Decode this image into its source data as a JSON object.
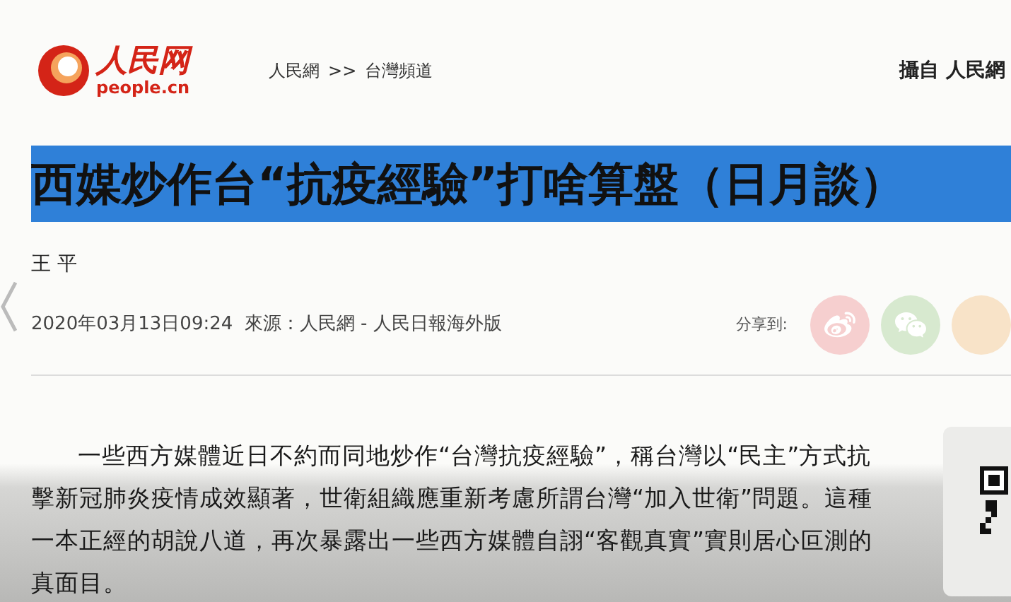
{
  "header": {
    "logo": {
      "name": "人民网",
      "domain": "people.cn"
    },
    "breadcrumb": [
      "人民網",
      ">>",
      "台灣頻道"
    ],
    "source_caption": "攝自 人民網"
  },
  "article": {
    "title": "西媒炒作台“抗疫經驗”打啥算盤（日月談）",
    "title_selected": true,
    "author": "王 平",
    "meta": "2020年03月13日09:24  來源：人民網 - 人民日報海外版",
    "share": {
      "label": "分享到:",
      "buttons": [
        {
          "kind": "weibo",
          "color": "#f6cfcf"
        },
        {
          "kind": "wechat",
          "color": "#d7e9cf"
        },
        {
          "kind": "other",
          "color": "#f8e3c8"
        }
      ]
    },
    "paragraph": "一些西方媒體近日不約而同地炒作“台灣抗疫經驗”，稱台灣以“民主”方式抗擊新冠肺炎疫情成效顯著，世衛組織應重新考慮所謂台灣“加入世衛”問題。這種一本正經的胡說八道，再次暴露出一些西方媒體自詡“客觀真實”實則居心叵測的真面目。"
  }
}
